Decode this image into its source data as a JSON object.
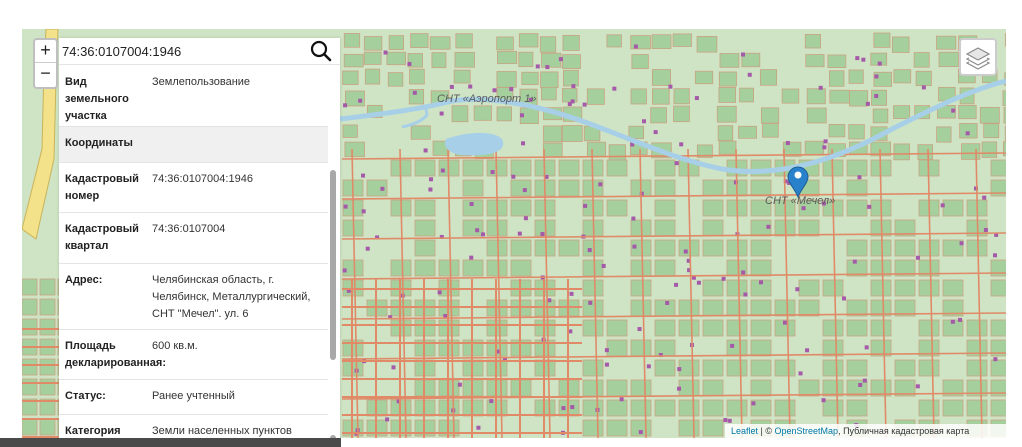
{
  "search": {
    "value": "74:36:0107004:1946"
  },
  "zoom": {
    "in_label": "+",
    "out_label": "−"
  },
  "info_rows": [
    {
      "key": "Вид земельного участка",
      "value": "Землепользование"
    },
    {
      "key": "Координаты",
      "value": ""
    },
    {
      "key": "Кадастровый номер",
      "value": "74:36:0107004:1946"
    },
    {
      "key": "Кадастровый квартал",
      "value": "74:36:0107004"
    },
    {
      "key": "Адрес:",
      "value": "Челябинская область, г. Челябинск, Металлургический, СНТ \"Мечел\". ул. 6"
    },
    {
      "key": "Площадь декларированная:",
      "value": "600 кв.м."
    },
    {
      "key": "Статус:",
      "value": "Ранее учтенный"
    },
    {
      "key": "Категория",
      "value": "Земли населенных пунктов"
    }
  ],
  "map": {
    "label_aeroport": "СНТ «Аэропорт 1»",
    "label_mechel": "СНТ «Мечел»",
    "colors": {
      "background": "#cfe4c4",
      "parcel": "#a5cf9d",
      "parcel_stroke": "#c9a382",
      "road": "#e08a68",
      "river": "#a7d0e8",
      "marker": "#2a81cb",
      "building": "#a45aa8"
    }
  },
  "attribution": {
    "leaflet": "Leaflet",
    "separator": " | © ",
    "osm": "OpenStreetMap",
    "rest": ", Публичная кадастровая карта"
  }
}
